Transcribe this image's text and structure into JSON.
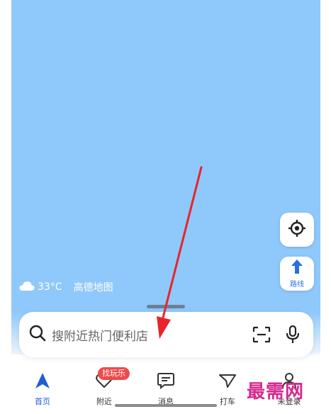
{
  "weather": {
    "icon": "cloud-icon",
    "temperature": "33°C",
    "provider": "高德地图"
  },
  "map_controls": {
    "locate_icon": "locate-icon",
    "route_label": "路线"
  },
  "search": {
    "placeholder": "搜附近热门便利店",
    "icons": [
      "search-icon",
      "scan-icon",
      "mic-icon"
    ]
  },
  "tabs": [
    {
      "label": "首页",
      "icon": "home-arrow-icon",
      "active": true
    },
    {
      "label": "附近",
      "icon": "heart-icon",
      "badge": "找玩乐"
    },
    {
      "label": "消息",
      "icon": "message-icon"
    },
    {
      "label": "打车",
      "icon": "taxi-icon"
    },
    {
      "label": "未登录",
      "icon": "user-icon"
    }
  ],
  "watermark": "最需网",
  "colors": {
    "map": "#8fc8fb",
    "accent": "#1f5fd6",
    "badge": "#ef4a4a",
    "arrow": "#e8242b"
  }
}
